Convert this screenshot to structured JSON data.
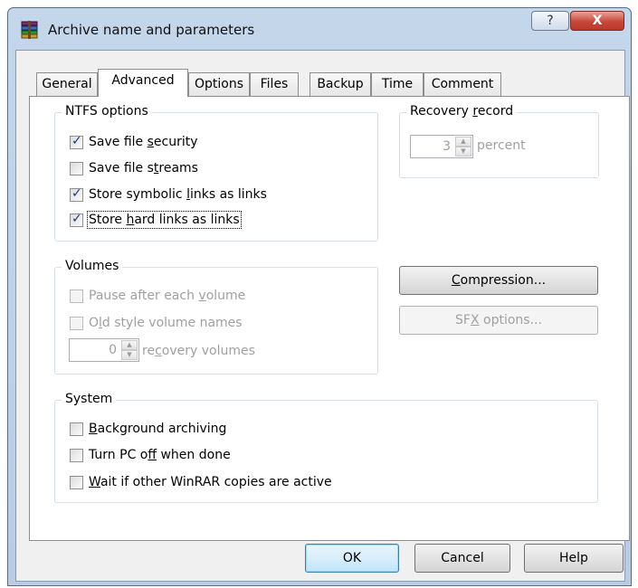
{
  "window": {
    "title": "Archive name and parameters",
    "help_glyph": "?",
    "close_glyph": "X"
  },
  "tabs": [
    "General",
    "Advanced",
    "Options",
    "Files",
    "Backup",
    "Time",
    "Comment"
  ],
  "active_tab": "Advanced",
  "ntfs": {
    "legend": "NTFS options",
    "items": [
      {
        "pre": "Save file ",
        "u": "s",
        "post": "ecurity",
        "checked": true
      },
      {
        "pre": "Save file s",
        "u": "t",
        "post": "reams",
        "checked": false
      },
      {
        "pre": "Store symbolic ",
        "u": "l",
        "post": "inks as links",
        "checked": true
      },
      {
        "pre": "Store ",
        "u": "h",
        "post": "ard links as links",
        "checked": true
      }
    ]
  },
  "recovery": {
    "legend_pre": "Recovery ",
    "legend_u": "r",
    "legend_post": "ecord",
    "value": "3",
    "unit": "percent"
  },
  "volumes": {
    "legend": "Volumes",
    "pause": {
      "pre": "Pause after each ",
      "u": "v",
      "post": "olume"
    },
    "old_style": {
      "pre": "O",
      "u": "l",
      "post": "d style volume names"
    },
    "recovery_value": "0",
    "recovery_pre": "re",
    "recovery_u": "c",
    "recovery_post": "overy volumes"
  },
  "buttons": {
    "compression_u": "C",
    "compression_rest": "ompression...",
    "sfx_pre": "SF",
    "sfx_u": "X",
    "sfx_post": " options...",
    "ok": "OK",
    "cancel": "Cancel",
    "help": "Help"
  },
  "system": {
    "legend": "System",
    "items": [
      {
        "pre": "",
        "u": "B",
        "post": "ackground archiving",
        "checked": false
      },
      {
        "pre": "Turn PC o",
        "u": "f",
        "post": "f when done",
        "checked": false
      },
      {
        "pre": "",
        "u": "W",
        "post": "ait if other WinRAR copies are active",
        "checked": false
      }
    ]
  }
}
